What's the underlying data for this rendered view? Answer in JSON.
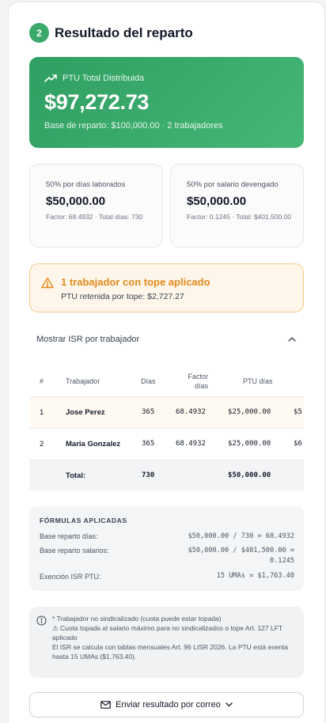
{
  "section": {
    "step_number": "2",
    "title": "Resultado del reparto"
  },
  "hero": {
    "label": "PTU Total Distribuida",
    "amount": "$97,272.73",
    "base": "Base de reparto: $100,000.00 · 2 trabajadores"
  },
  "split_days": {
    "label": "50% por días laborados",
    "value": "$50,000.00",
    "meta": "Factor: 68.4932 · Total días: 730"
  },
  "split_salary": {
    "label": "50% por salario devengado",
    "value": "$50,000.00",
    "meta": "Factor: 0.1245 · Total: $401,500.00"
  },
  "warning": {
    "title": "1 trabajador con tope aplicado",
    "subtitle": "PTU retenida por tope: $2,727.27"
  },
  "isr_toggle": {
    "label": "Mostrar ISR por trabajador"
  },
  "table": {
    "headers": {
      "num": "#",
      "worker": "Trabajador",
      "days": "Días",
      "factor": "Factor días",
      "ptu_days": "PTU días"
    },
    "rows": [
      {
        "num": "1",
        "worker": "Jose Perez",
        "days": "365",
        "factor": "68.4932",
        "ptu_days": "$25,000.00",
        "next": "$5"
      },
      {
        "num": "2",
        "worker": "Maria Gonzalez",
        "days": "365",
        "factor": "68.4932",
        "ptu_days": "$25,000.00",
        "next": "$6"
      }
    ],
    "total": {
      "label": "Total:",
      "days": "730",
      "ptu_days": "$50,000.00"
    }
  },
  "formulas": {
    "title": "FÓRMULAS APLICADAS",
    "items": [
      {
        "label": "Base reparto días:",
        "value": "$50,000.00 / 730 = 68.4932"
      },
      {
        "label": "Base reparto salarios:",
        "value": "$50,000.00 / $401,500.00 = 0.1245"
      },
      {
        "label": "Exención ISR PTU:",
        "value": "15 UMAs = $1,763.40"
      }
    ]
  },
  "notes": {
    "line1": "* Trabajador no sindicalizado (cuota puede estar topada)",
    "line2": "⚠ Cuota topada al salario máximo para no sindicalizados o tope Art. 127 LFT aplicado",
    "line3": "El ISR se calcula con tablas mensuales Art. 96 LISR 2026. La PTU está exenta hasta 15 UMAs ($1,763.40)."
  },
  "email_button": {
    "label": "Enviar resultado por correo"
  },
  "colors": {
    "accent": "#3aa96b",
    "warning": "#e38a1e",
    "warning_bg": "#fef6ea"
  },
  "icons": [
    "trending-up-icon",
    "warning-triangle-icon",
    "chevron-up-icon",
    "info-icon",
    "mail-icon",
    "chevron-down-icon"
  ]
}
